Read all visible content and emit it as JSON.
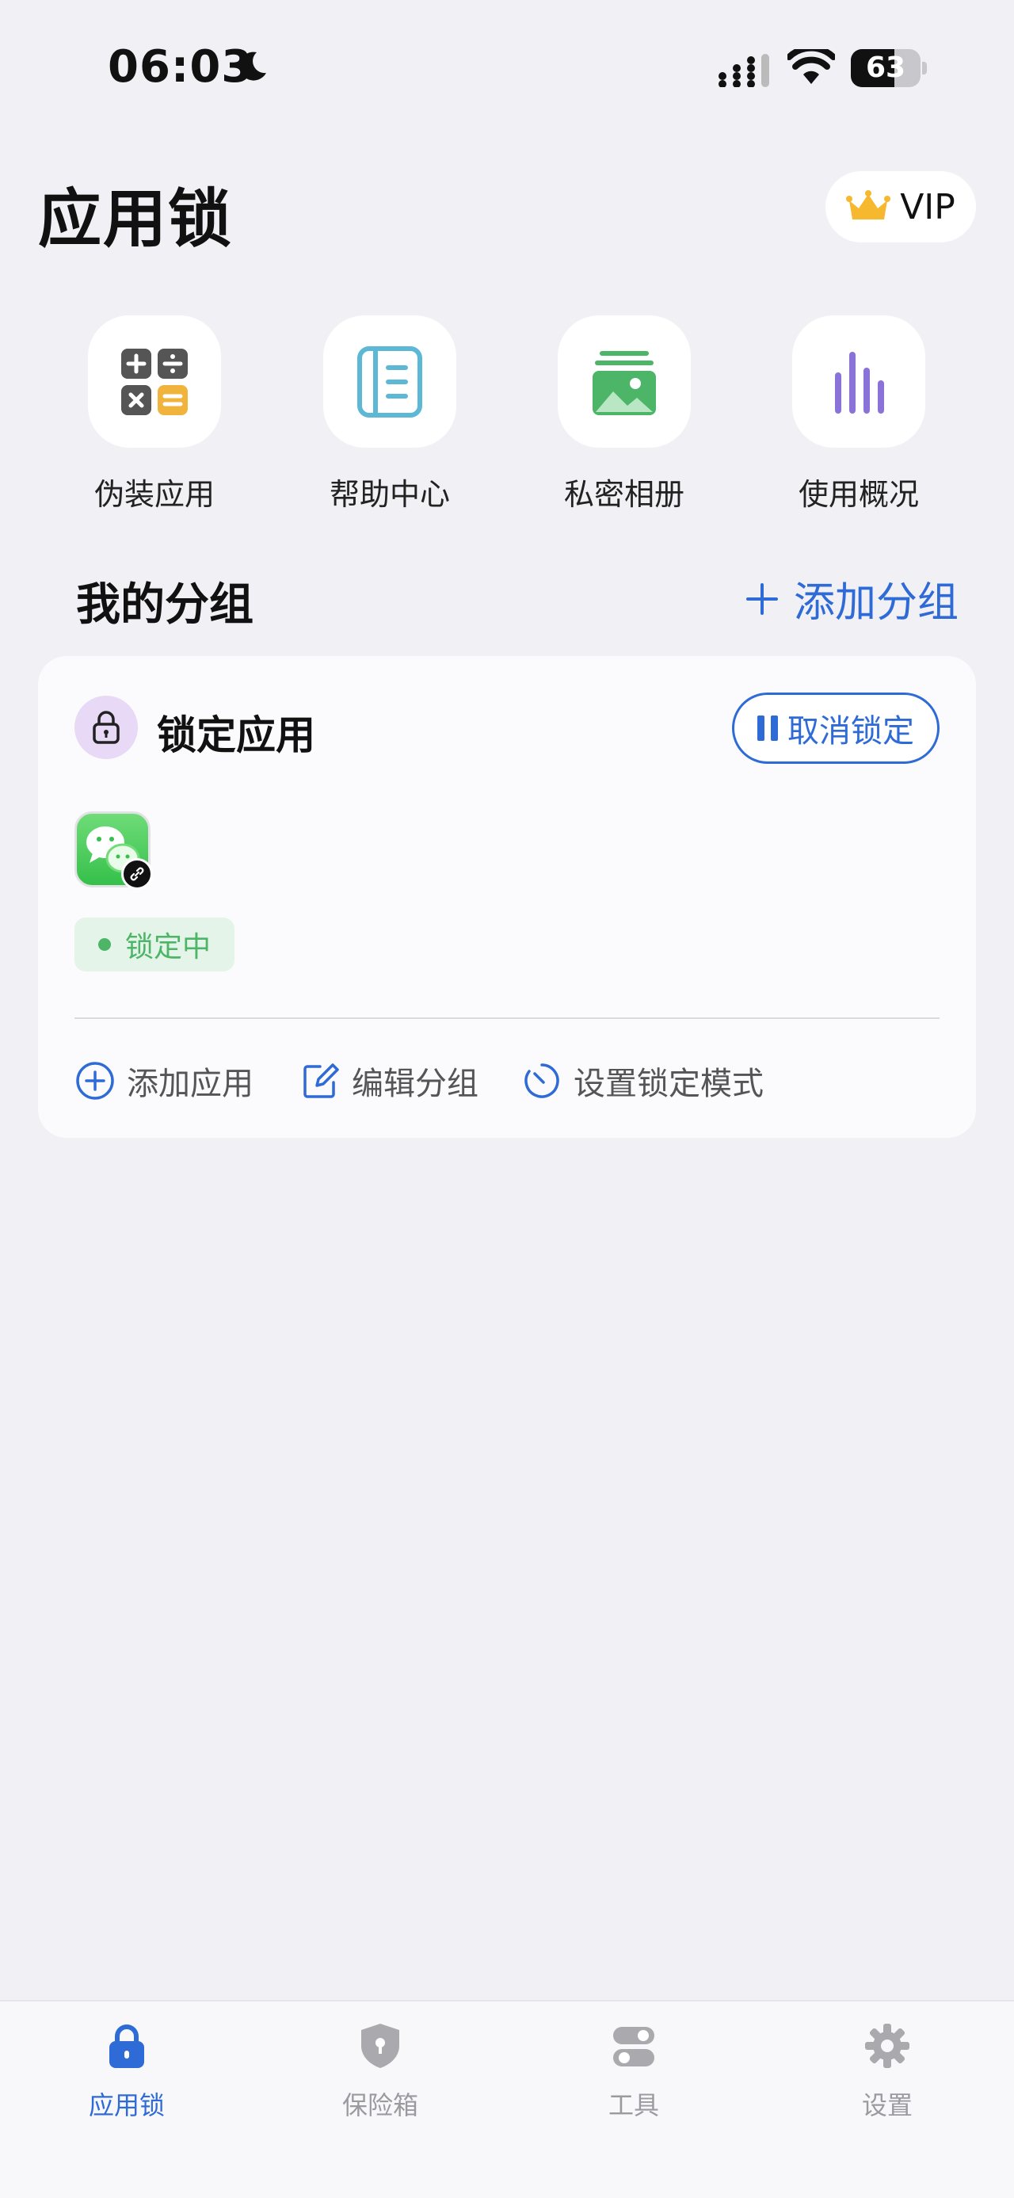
{
  "status_bar": {
    "time": "06:03",
    "battery": "63",
    "battery_level": 0.63
  },
  "header": {
    "title": "应用锁",
    "vip_label": "VIP"
  },
  "quick_actions": [
    {
      "label": "伪装应用",
      "icon": "calculator-icon"
    },
    {
      "label": "帮助中心",
      "icon": "help-book-icon"
    },
    {
      "label": "私密相册",
      "icon": "photo-album-icon"
    },
    {
      "label": "使用概况",
      "icon": "usage-bars-icon"
    }
  ],
  "groups_section": {
    "title": "我的分组",
    "add_label": "添加分组"
  },
  "group_card": {
    "title": "锁定应用",
    "unlock_label": "取消锁定",
    "status": "锁定中",
    "actions": [
      {
        "label": "添加应用",
        "icon": "plus-circle-icon"
      },
      {
        "label": "编辑分组",
        "icon": "edit-icon"
      },
      {
        "label": "设置锁定模式",
        "icon": "timer-icon"
      }
    ]
  },
  "colors": {
    "accent": "#2f6bd6",
    "locked_green": "#4cb567",
    "background": "#f0f0f5"
  },
  "tab_bar": [
    {
      "label": "应用锁",
      "icon": "lock-icon",
      "active": true
    },
    {
      "label": "保险箱",
      "icon": "shield-icon",
      "active": false
    },
    {
      "label": "工具",
      "icon": "toggles-icon",
      "active": false
    },
    {
      "label": "设置",
      "icon": "gear-icon",
      "active": false
    }
  ]
}
